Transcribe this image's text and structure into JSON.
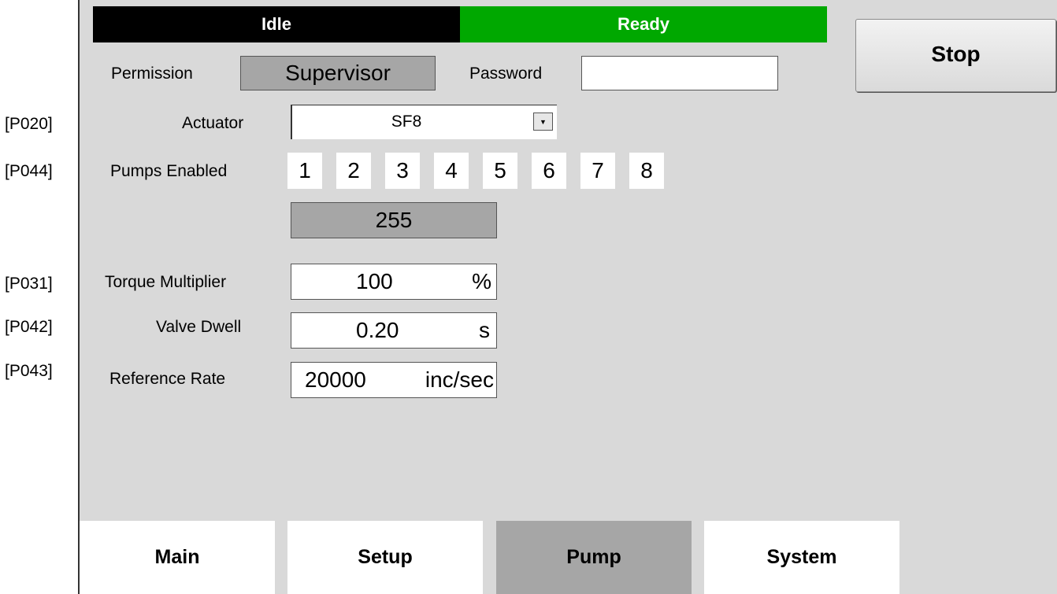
{
  "param_codes": [
    "[P020]",
    "[P044]",
    "[P031]",
    "[P042]",
    "[P043]"
  ],
  "status": {
    "left": "Idle",
    "right": "Ready"
  },
  "stop_label": "Stop",
  "permission": {
    "label": "Permission",
    "value": "Supervisor"
  },
  "password": {
    "label": "Password",
    "value": ""
  },
  "actuator": {
    "label": "Actuator",
    "value": "SF8"
  },
  "pumps": {
    "label": "Pumps Enabled",
    "numbers": [
      "1",
      "2",
      "3",
      "4",
      "5",
      "6",
      "7",
      "8"
    ],
    "mask": "255"
  },
  "torque": {
    "label": "Torque Multiplier",
    "value": "100",
    "unit": "%"
  },
  "dwell": {
    "label": "Valve Dwell",
    "value": "0.20",
    "unit": "s"
  },
  "refrate": {
    "label": "Reference Rate",
    "value": "20000",
    "unit": "inc/sec"
  },
  "tabs": [
    "Main",
    "Setup",
    "Pump",
    "System"
  ],
  "active_tab": "Pump",
  "colors": {
    "idle_bg": "#000000",
    "ready_bg": "#00a800",
    "panel_bg": "#d9d9d9",
    "readonly_bg": "#a6a6a6"
  }
}
